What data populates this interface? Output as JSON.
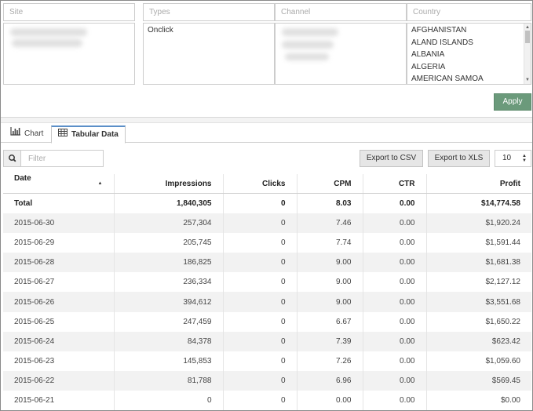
{
  "filters": {
    "site": {
      "placeholder": "Site"
    },
    "types": {
      "placeholder": "Types",
      "options": [
        "Onclick"
      ]
    },
    "channel": {
      "placeholder": "Channel"
    },
    "country": {
      "placeholder": "Country",
      "options": [
        "AFGHANISTAN",
        "ALAND ISLANDS",
        "ALBANIA",
        "ALGERIA",
        "AMERICAN SAMOA"
      ]
    },
    "apply_label": "Apply"
  },
  "tabs": [
    {
      "label": "Chart",
      "icon": "bar-chart-icon",
      "active": false
    },
    {
      "label": "Tabular Data",
      "icon": "table-icon",
      "active": true
    }
  ],
  "toolbar": {
    "filter_placeholder": "Filter",
    "export_csv_label": "Export to CSV",
    "export_xls_label": "Export to XLS",
    "page_size": "10"
  },
  "table": {
    "columns": [
      "Date",
      "Impressions",
      "Clicks",
      "CPM",
      "CTR",
      "Profit"
    ],
    "sorted_column": "Date",
    "total": {
      "label": "Total",
      "impressions": "1,840,305",
      "clicks": "0",
      "cpm": "8.03",
      "ctr": "0.00",
      "profit": "$14,774.58"
    },
    "rows": [
      {
        "date": "2015-06-30",
        "impressions": "257,304",
        "clicks": "0",
        "cpm": "7.46",
        "ctr": "0.00",
        "profit": "$1,920.24"
      },
      {
        "date": "2015-06-29",
        "impressions": "205,745",
        "clicks": "0",
        "cpm": "7.74",
        "ctr": "0.00",
        "profit": "$1,591.44"
      },
      {
        "date": "2015-06-28",
        "impressions": "186,825",
        "clicks": "0",
        "cpm": "9.00",
        "ctr": "0.00",
        "profit": "$1,681.38"
      },
      {
        "date": "2015-06-27",
        "impressions": "236,334",
        "clicks": "0",
        "cpm": "9.00",
        "ctr": "0.00",
        "profit": "$2,127.12"
      },
      {
        "date": "2015-06-26",
        "impressions": "394,612",
        "clicks": "0",
        "cpm": "9.00",
        "ctr": "0.00",
        "profit": "$3,551.68"
      },
      {
        "date": "2015-06-25",
        "impressions": "247,459",
        "clicks": "0",
        "cpm": "6.67",
        "ctr": "0.00",
        "profit": "$1,650.22"
      },
      {
        "date": "2015-06-24",
        "impressions": "84,378",
        "clicks": "0",
        "cpm": "7.39",
        "ctr": "0.00",
        "profit": "$623.42"
      },
      {
        "date": "2015-06-23",
        "impressions": "145,853",
        "clicks": "0",
        "cpm": "7.26",
        "ctr": "0.00",
        "profit": "$1,059.60"
      },
      {
        "date": "2015-06-22",
        "impressions": "81,788",
        "clicks": "0",
        "cpm": "6.96",
        "ctr": "0.00",
        "profit": "$569.45"
      },
      {
        "date": "2015-06-21",
        "impressions": "0",
        "clicks": "0",
        "cpm": "0.00",
        "ctr": "0.00",
        "profit": "$0.00"
      }
    ]
  },
  "colors": {
    "apply": "#6b9a7b",
    "tab_accent": "#5b8fc8",
    "row_stripe": "#f2f2f2"
  }
}
